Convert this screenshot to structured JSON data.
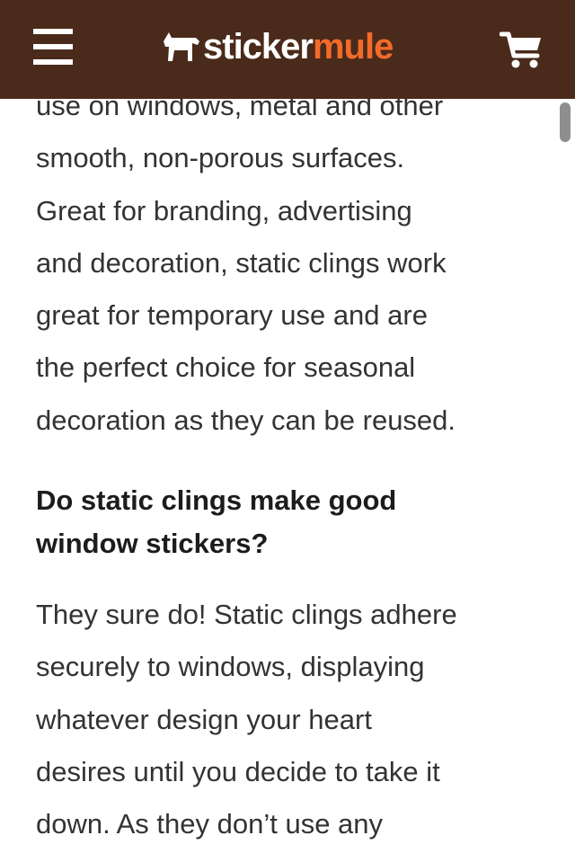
{
  "header": {
    "background_color": "#4a2a1a",
    "logo": {
      "word1": "sticker",
      "word2": "mule",
      "accent_color": "#f26b29",
      "icon": "mule-icon"
    },
    "menu_icon": "hamburger-menu-icon",
    "cart_icon": "cart-icon"
  },
  "article": {
    "intro_lines": [
      "use on windows, metal and other",
      "smooth, non-porous surfaces.",
      "Great for branding, advertising",
      "and decoration, static clings work",
      "great for temporary use and are",
      "the perfect choice for seasonal",
      "decoration as they can be reused."
    ],
    "faq_heading_lines": [
      "Do static clings make good",
      "window stickers?"
    ],
    "faq_answer_lines": [
      "They sure do! Static clings adhere",
      "securely to windows, displaying",
      "whatever design your heart",
      "desires until you decide to take it",
      "down. As they don’t use any"
    ]
  },
  "colors": {
    "body_text": "#333333",
    "heading_text": "#1c1c1c",
    "scrollbar": "#8e8e8e"
  }
}
